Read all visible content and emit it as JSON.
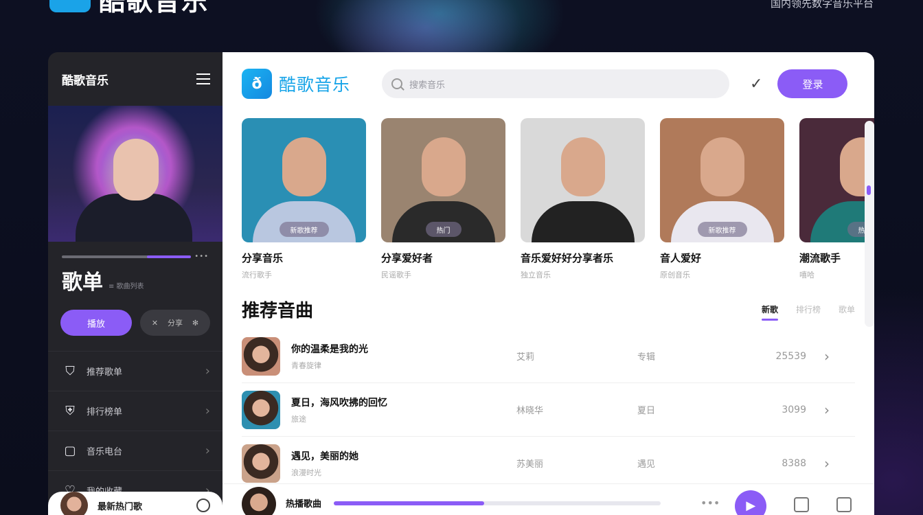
{
  "app": {
    "name": "酷歌音乐",
    "tagline": "国内领先数字音乐平台"
  },
  "sidebar": {
    "title": "酷歌音乐",
    "progress": 0.66,
    "playlist_title": "歌单",
    "playlist_sub": "≡ 歌曲列表",
    "primary_btn": "播放",
    "secondary_btn": "分享",
    "nav": [
      {
        "label": "推荐歌单",
        "icon": "tag-icon"
      },
      {
        "label": "排行榜单",
        "icon": "shield-icon"
      },
      {
        "label": "音乐电台",
        "icon": "radio-icon"
      },
      {
        "label": "我的收藏",
        "icon": "heart-icon"
      }
    ],
    "now_playing": "最新热门歌"
  },
  "header": {
    "brand": "酷歌音乐",
    "logo_glyph": "ð",
    "search_placeholder": "搜索音乐",
    "login_btn": "登录"
  },
  "artists": [
    {
      "name": "分享音乐",
      "sub": "流行歌手",
      "badge": "新歌推荐",
      "bg": "#2a8fb4",
      "shirt": "#b9c7e0"
    },
    {
      "name": "分享爱好者",
      "sub": "民谣歌手",
      "badge": "热门",
      "bg": "#9a8470",
      "shirt": "#2a2a2a"
    },
    {
      "name": "音乐爱好好分享者乐",
      "sub": "独立音乐",
      "badge": "",
      "bg": "#d9d9d9",
      "shirt": "#222"
    },
    {
      "name": "音人爱好",
      "sub": "原创音乐",
      "badge": "新歌推荐",
      "bg": "#b07a5a",
      "shirt": "#e9e7ef"
    },
    {
      "name": "潮流歌手",
      "sub": "嘻哈",
      "badge": "热",
      "bg": "#4a2a3a",
      "shirt": "#1f7a78"
    }
  ],
  "recommend": {
    "title": "推荐音曲",
    "tabs": [
      "新歌",
      "排行榜",
      "歌单"
    ],
    "active_tab": 0,
    "songs": [
      {
        "title": "你的温柔是我的光",
        "sub": "青春旋律",
        "artist": "艾莉",
        "album": "专辑",
        "plays": "25539"
      },
      {
        "title": "夏日，海风吹拂的回忆",
        "sub": "旅途",
        "artist": "林晓华",
        "album": "夏日",
        "plays": "3099"
      },
      {
        "title": "遇见，美丽的她",
        "sub": "浪漫时光",
        "artist": "苏美丽",
        "album": "遇见",
        "plays": "8388"
      }
    ]
  },
  "player": {
    "title": "热播歌曲",
    "progress": 0.46
  },
  "colors": {
    "accent": "#8b5cf6",
    "brand": "#17a4e8"
  }
}
